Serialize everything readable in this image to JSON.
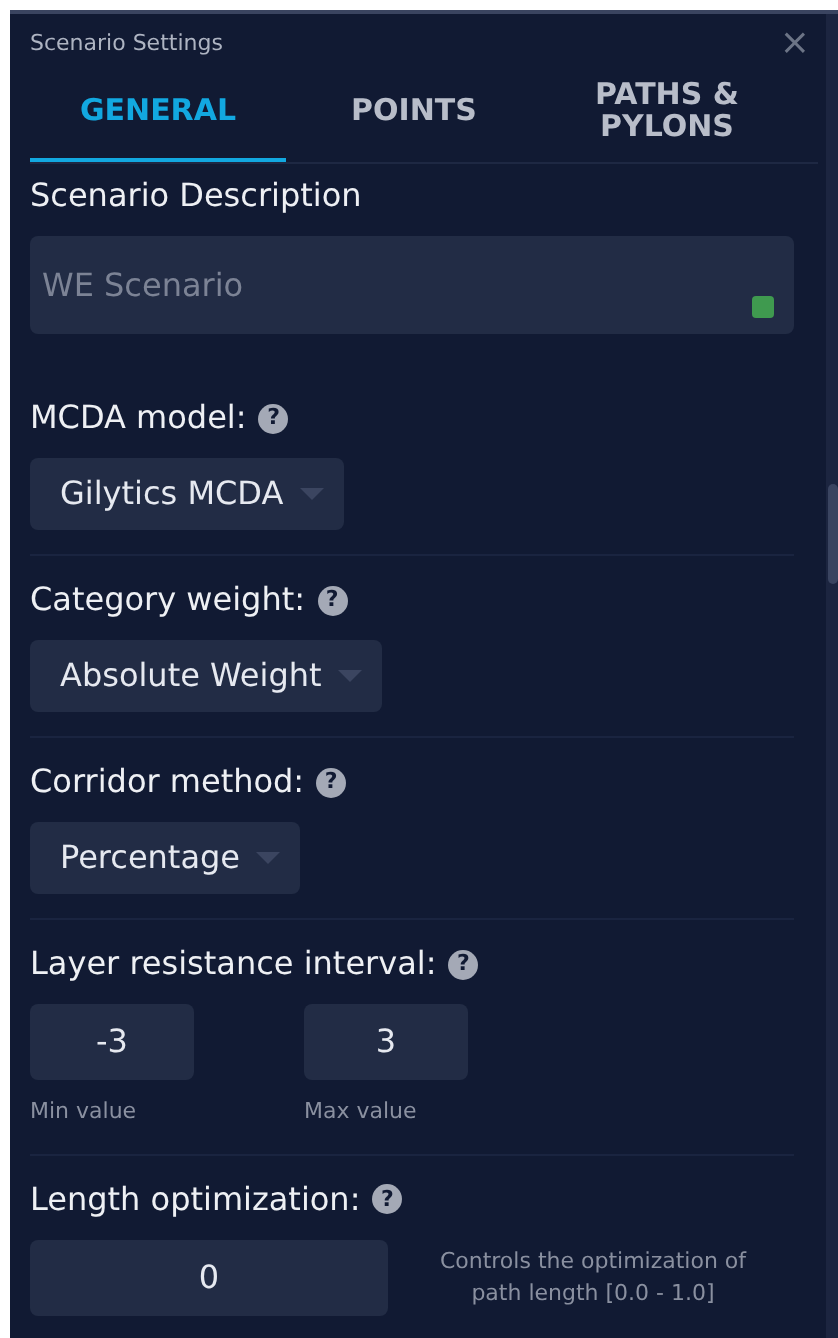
{
  "window": {
    "title": "Scenario Settings",
    "close": "×"
  },
  "tabs": [
    {
      "label": "GENERAL",
      "selected": true
    },
    {
      "label": "POINTS",
      "selected": false
    },
    {
      "label": "PATHS & PYLONS",
      "selected": false
    }
  ],
  "description": {
    "label": "Scenario Description",
    "placeholder": "WE Scenario"
  },
  "fields": [
    {
      "kind": "select",
      "label": "MCDA model:",
      "help": "?",
      "value": "Gilytics MCDA"
    },
    {
      "kind": "select",
      "label": "Category weight:",
      "help": "?",
      "value": "Absolute Weight"
    },
    {
      "kind": "select",
      "label": "Corridor method:",
      "help": "?",
      "value": "Percentage"
    },
    {
      "kind": "range",
      "label": "Layer resistance interval:",
      "help": "?",
      "min": {
        "value": "-3",
        "caption": "Min value"
      },
      "max": {
        "value": "3",
        "caption": "Max value"
      }
    },
    {
      "kind": "number",
      "label": "Length optimization:",
      "help": "?",
      "value": "0",
      "hint": "Controls the optimization of path length [0.0 - 1.0]"
    }
  ]
}
